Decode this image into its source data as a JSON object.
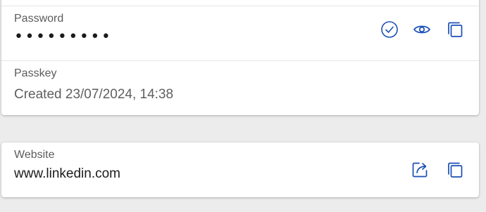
{
  "colors": {
    "accent": "#1a4fb5",
    "background": "#ececec",
    "card": "#ffffff"
  },
  "password": {
    "label": "Password",
    "value": "•••••••••",
    "actions": [
      "check-icon",
      "eye-icon",
      "copy-icon"
    ]
  },
  "passkey": {
    "label": "Passkey",
    "value": "Created 23/07/2024, 14:38"
  },
  "website": {
    "label": "Website",
    "value": "www.linkedin.com",
    "actions": [
      "open-external-icon",
      "copy-icon"
    ]
  }
}
